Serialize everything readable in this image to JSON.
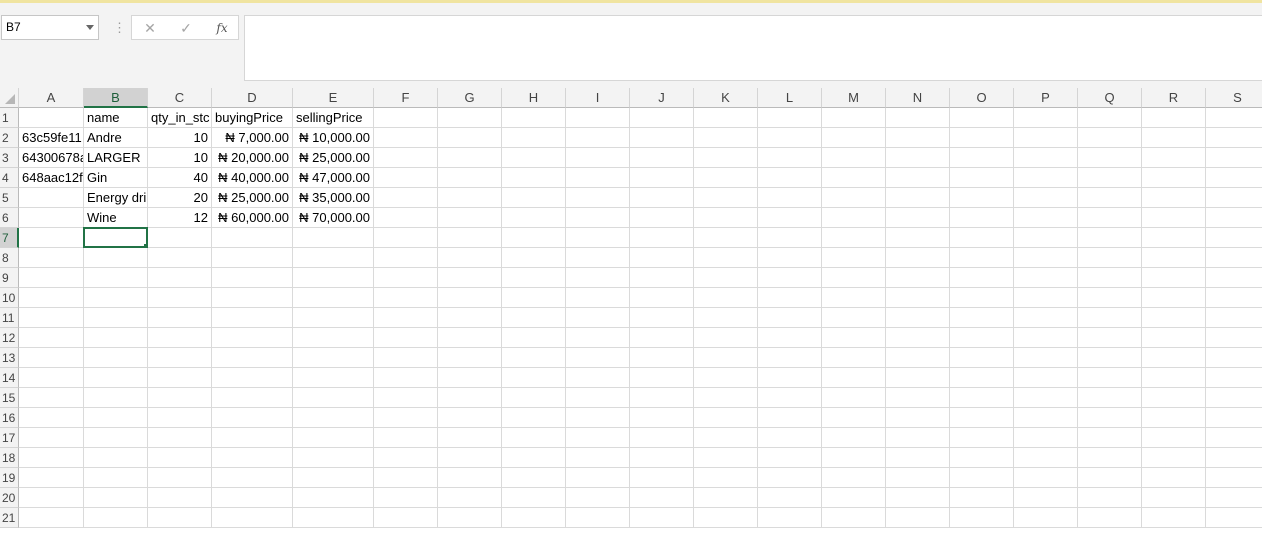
{
  "name_box": {
    "value": "B7"
  },
  "formula_bar": {
    "fx_label": "fx",
    "cancel_icon": "close-icon",
    "enter_icon": "check-icon",
    "content": ""
  },
  "columns": [
    "A",
    "B",
    "C",
    "D",
    "E",
    "F",
    "G",
    "H",
    "I",
    "J",
    "K",
    "L",
    "M",
    "N",
    "O",
    "P",
    "Q",
    "R",
    "S"
  ],
  "rows": [
    "1",
    "2",
    "3",
    "4",
    "5",
    "6",
    "7",
    "8",
    "9",
    "10",
    "11",
    "12",
    "13",
    "14",
    "15",
    "16",
    "17",
    "18",
    "19",
    "20",
    "21"
  ],
  "active_cell": "B7",
  "headers": {
    "A": "",
    "B": "name",
    "C": "qty_in_stc",
    "D": "buyingPrice",
    "E": "sellingPrice"
  },
  "records": [
    {
      "A": "63c59fe11",
      "B": "Andre",
      "C": "10",
      "D": "₦ 7,000.00",
      "E": "₦ 10,000.00"
    },
    {
      "A": "64300678a",
      "B": "LARGER",
      "C": "10",
      "D": "₦ 20,000.00",
      "E": "₦ 25,000.00"
    },
    {
      "A": "648aac12f",
      "B": "Gin",
      "C": "40",
      "D": "₦ 40,000.00",
      "E": "₦ 47,000.00"
    },
    {
      "A": "",
      "B": "Energy dri",
      "C": "20",
      "D": "₦ 25,000.00",
      "E": "₦ 35,000.00"
    },
    {
      "A": "",
      "B": "Wine",
      "C": "12",
      "D": "₦ 60,000.00",
      "E": "₦ 70,000.00"
    }
  ],
  "colors": {
    "accent": "#217346",
    "header_bg": "#f3f3f3",
    "gridline": "#dadada"
  }
}
